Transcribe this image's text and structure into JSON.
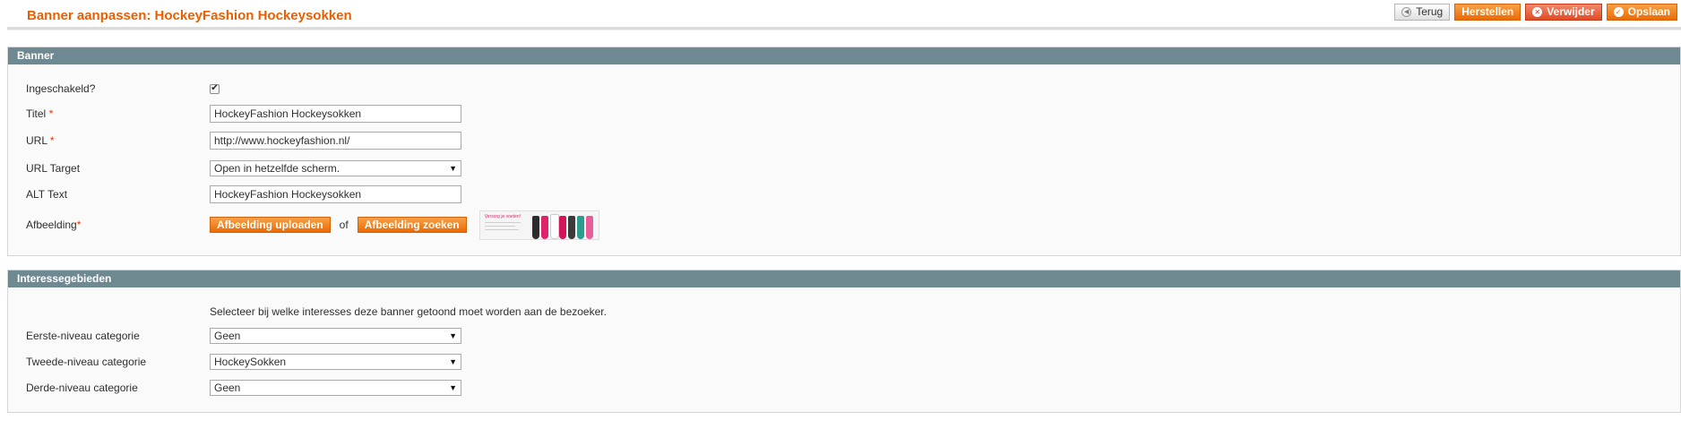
{
  "header": {
    "title": "Banner aanpassen: HockeyFashion Hockeysokken",
    "buttons": {
      "back": "Terug",
      "reset": "Herstellen",
      "delete": "Verwijder",
      "save": "Opslaan"
    }
  },
  "banner": {
    "heading": "Banner",
    "enabled": {
      "label": "Ingeschakeld?",
      "checked": true
    },
    "title": {
      "label": "Titel",
      "required": "*",
      "value": "HockeyFashion Hockeysokken"
    },
    "url": {
      "label": "URL",
      "required": "*",
      "value": "http://www.hockeyfashion.nl/"
    },
    "url_target": {
      "label": "URL Target",
      "selected": "Open in hetzelfde scherm."
    },
    "alt_text": {
      "label": "ALT Text",
      "value": "HockeyFashion Hockeysokken"
    },
    "image": {
      "label": "Afbeelding",
      "required": "*",
      "upload_label": "Afbeelding uploaden",
      "or_text": "of",
      "search_label": "Afbeelding zoeken",
      "thumb_caption": "Versorg je voeten!"
    }
  },
  "interests": {
    "heading": "Interessegebieden",
    "description": "Selecteer bij welke interesses deze banner getoond moet worden aan de bezoeker.",
    "level1": {
      "label": "Eerste-niveau categorie",
      "selected": "Geen"
    },
    "level2": {
      "label": "Tweede-niveau categorie",
      "selected": "HockeySokken"
    },
    "level3": {
      "label": "Derde-niveau categorie",
      "selected": "Geen"
    }
  },
  "colors": {
    "title_orange": "#eb5e00",
    "button_orange": "#ec6a04",
    "button_red": "#e24b28",
    "section_header": "#6f8992",
    "required_red": "#eb340a"
  }
}
